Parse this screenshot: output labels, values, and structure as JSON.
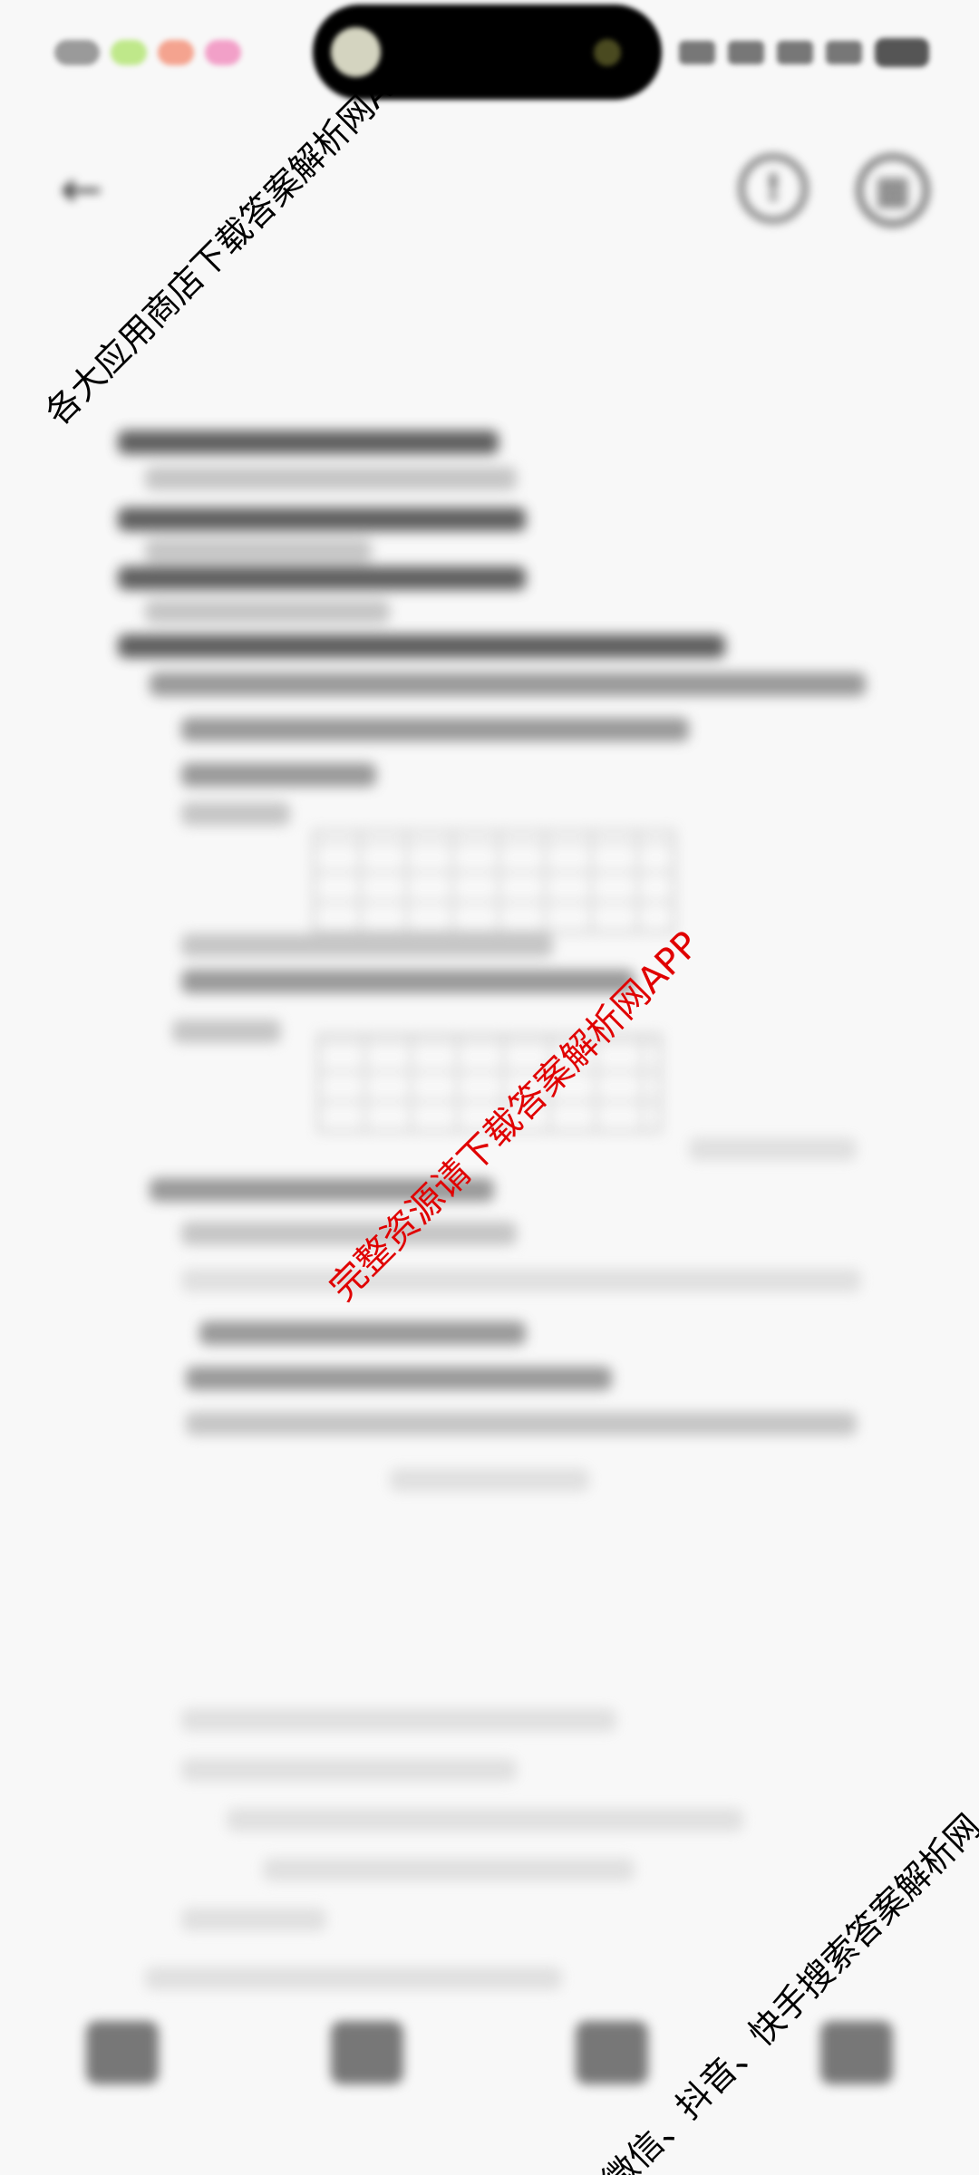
{
  "status_bar": {
    "time": "",
    "battery": ""
  },
  "toolbar": {
    "back_icon": "back-arrow-icon",
    "info_icon": "info-icon",
    "grid_icon": "grid-icon"
  },
  "document": {
    "title": ""
  },
  "bottom_nav": {
    "items": [
      {
        "label": "",
        "icon": "home-icon"
      },
      {
        "label": "",
        "icon": "book-icon"
      },
      {
        "label": "",
        "icon": "camera-icon"
      },
      {
        "label": "",
        "icon": "apps-icon"
      }
    ]
  },
  "watermarks": {
    "top": "各大应用商店下载答案解析网APP",
    "center": "完整资源请下载答案解析网APP",
    "bottom": "微信、抖音、快手搜索答案解析网"
  },
  "colors": {
    "center_watermark": "#e00000",
    "corner_watermark": "#000000",
    "background": "#f8f8f8"
  }
}
